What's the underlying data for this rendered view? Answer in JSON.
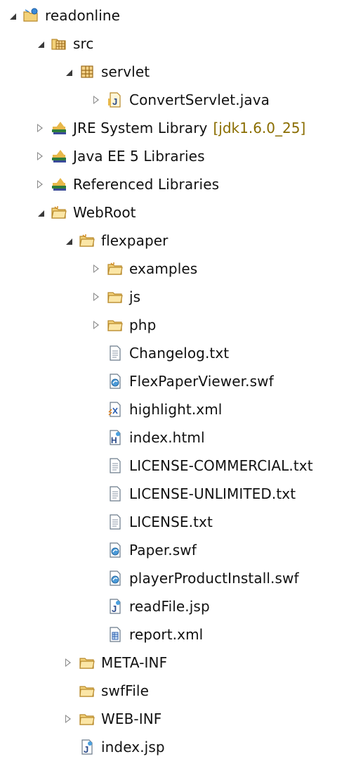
{
  "tree": {
    "project": {
      "label": "readonline",
      "icon": "project-folder-icon"
    },
    "src": {
      "label": "src",
      "icon": "source-folder-icon"
    },
    "servlet": {
      "label": "servlet",
      "icon": "package-icon"
    },
    "convert_servlet": {
      "label": "ConvertServlet.java",
      "icon": "java-file-icon"
    },
    "jre": {
      "label": "JRE System Library",
      "decoration": "[jdk1.6.0_25]",
      "icon": "library-icon"
    },
    "javaee": {
      "label": "Java EE 5 Libraries",
      "icon": "library-icon"
    },
    "referenced": {
      "label": "Referenced Libraries",
      "icon": "library-icon"
    },
    "webroot": {
      "label": "WebRoot",
      "icon": "web-folder-icon"
    },
    "flexpaper": {
      "label": "flexpaper",
      "icon": "web-folder-icon"
    },
    "examples": {
      "label": "examples",
      "icon": "web-folder-icon"
    },
    "js": {
      "label": "js",
      "icon": "folder-icon"
    },
    "php": {
      "label": "php",
      "icon": "folder-icon"
    },
    "changelog": {
      "label": "Changelog.txt",
      "icon": "text-file-icon"
    },
    "flexpaperviewer": {
      "label": "FlexPaperViewer.swf",
      "icon": "swf-file-icon"
    },
    "highlight": {
      "label": "highlight.xml",
      "icon": "xml-file-icon"
    },
    "index_html": {
      "label": "index.html",
      "icon": "html-file-icon"
    },
    "license_commercial": {
      "label": "LICENSE-COMMERCIAL.txt",
      "icon": "text-file-icon"
    },
    "license_unlimited": {
      "label": "LICENSE-UNLIMITED.txt",
      "icon": "text-file-icon"
    },
    "license": {
      "label": "LICENSE.txt",
      "icon": "text-file-icon"
    },
    "paper": {
      "label": "Paper.swf",
      "icon": "swf-file-icon"
    },
    "player_install": {
      "label": "playerProductInstall.swf",
      "icon": "swf-file-icon"
    },
    "readfile": {
      "label": "readFile.jsp",
      "icon": "jsp-file-icon"
    },
    "report": {
      "label": "report.xml",
      "icon": "report-xml-icon"
    },
    "meta_inf": {
      "label": "META-INF",
      "icon": "folder-icon"
    },
    "swffile": {
      "label": "swfFile",
      "icon": "folder-icon"
    },
    "web_inf": {
      "label": "WEB-INF",
      "icon": "folder-icon"
    },
    "index_jsp": {
      "label": "index.jsp",
      "icon": "jsp-file-icon"
    }
  },
  "colors": {
    "folder": "#e8b84a",
    "library": "#2d7d3a",
    "decoration": "#8a6d00"
  }
}
